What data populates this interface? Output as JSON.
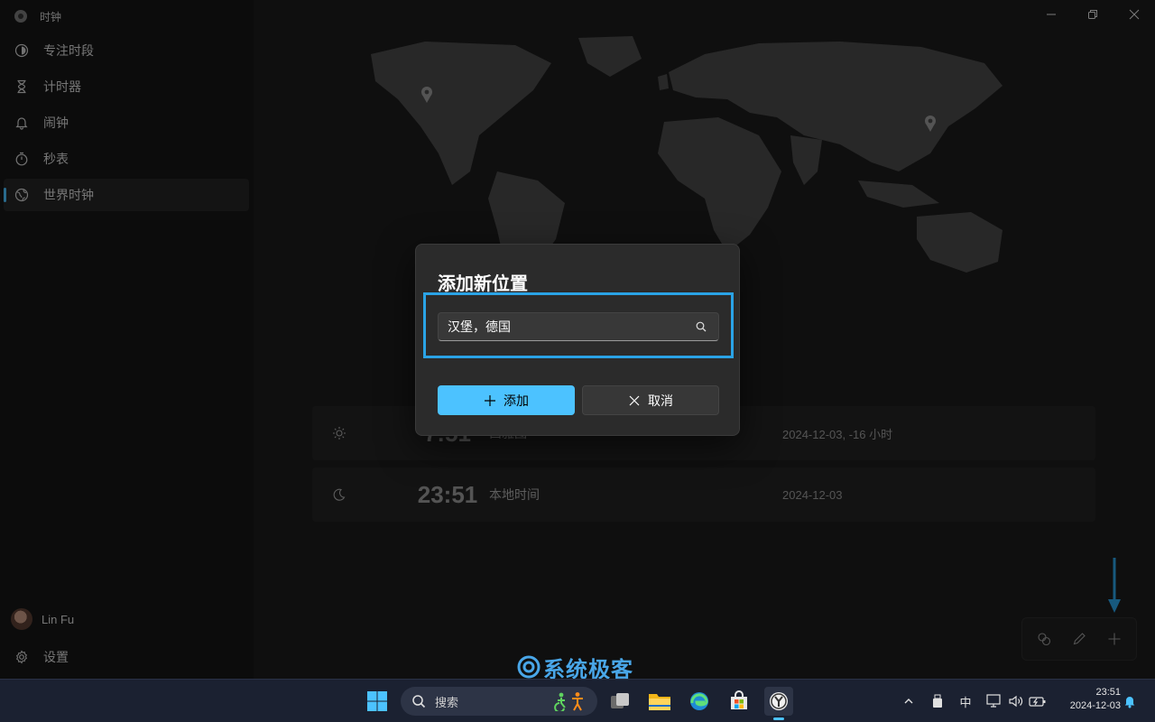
{
  "app": {
    "title": "时钟",
    "icon": "clock-app-icon"
  },
  "sidebar": {
    "items": [
      {
        "label": "专注时段",
        "icon": "focus-icon"
      },
      {
        "label": "计时器",
        "icon": "hourglass-icon"
      },
      {
        "label": "闹钟",
        "icon": "bell-icon"
      },
      {
        "label": "秒表",
        "icon": "stopwatch-icon"
      },
      {
        "label": "世界时钟",
        "icon": "globe-icon",
        "active": true
      }
    ],
    "user": {
      "name": "Lin Fu"
    },
    "settings_label": "设置"
  },
  "world_clocks": [
    {
      "time": "7:51",
      "name": "西雅图",
      "date": "2024-12-03, -16 小时",
      "icon": "sun-icon"
    },
    {
      "time": "23:51",
      "name": "本地时间",
      "date": "2024-12-03",
      "icon": "moon-icon"
    }
  ],
  "dialog": {
    "title": "添加新位置",
    "search_value": "汉堡，德国",
    "add_label": "添加",
    "cancel_label": "取消"
  },
  "watermark": {
    "text": "系统极客"
  },
  "taskbar": {
    "search_label": "搜索",
    "tray_ime": "中",
    "clock_time": "23:51",
    "clock_date": "2024-12-03"
  },
  "colors": {
    "accent": "#4cc2ff",
    "highlight": "#2aa3e6",
    "sidebar_bg": "#161616",
    "main_bg": "#1c1c1c"
  }
}
